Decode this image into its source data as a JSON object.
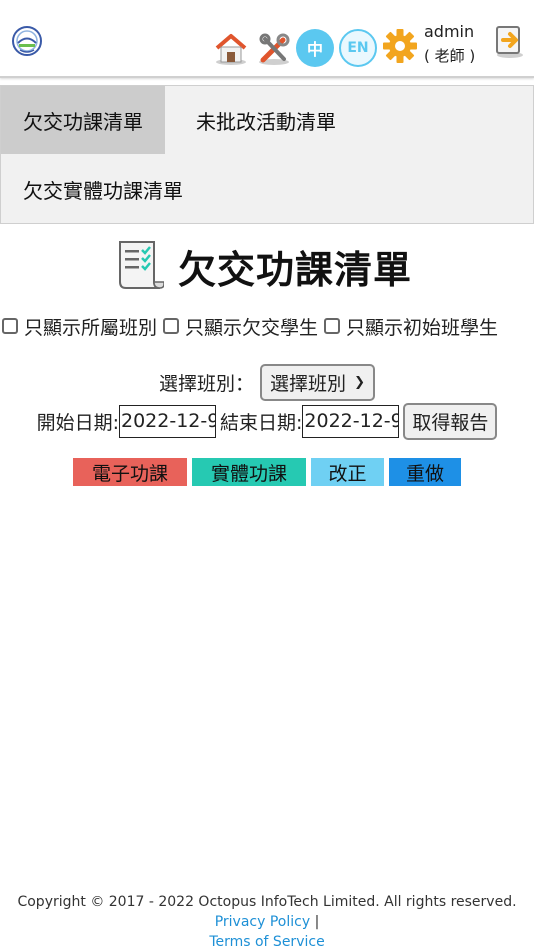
{
  "header": {
    "user_name": "admin",
    "user_role": "( 老師 )",
    "lang_zh": "中",
    "lang_en": "EN"
  },
  "tabs": [
    {
      "label": "欠交功課清單",
      "active": true
    },
    {
      "label": "未批改活動清單",
      "active": false
    },
    {
      "label": "欠交實體功課清單",
      "active": false
    }
  ],
  "page_title": "欠交功課清單",
  "filters": [
    {
      "label": "只顯示所屬班別",
      "checked": false
    },
    {
      "label": "只顯示欠交學生",
      "checked": false
    },
    {
      "label": "只顯示初始班學生",
      "checked": false
    }
  ],
  "class_select": {
    "label": "選擇班別：",
    "selected": "選擇班別"
  },
  "dates": {
    "start_label": "開始日期:",
    "start_value": "2022-12-9",
    "end_label": "結束日期:",
    "end_value": "2022-12-9",
    "get_report_label": "取得報告"
  },
  "legend": [
    {
      "label": "電子功課",
      "color": "#e8625a"
    },
    {
      "label": "實體功課",
      "color": "#26c9b2"
    },
    {
      "label": "改正",
      "color": "#6fd0f3"
    },
    {
      "label": "重做",
      "color": "#1e90e6"
    }
  ],
  "footer": {
    "copyright": "Copyright © 2017 - 2022 Octopus InfoTech Limited. All rights reserved.",
    "privacy": "Privacy Policy",
    "separator": "|",
    "terms": "Terms of Service"
  }
}
